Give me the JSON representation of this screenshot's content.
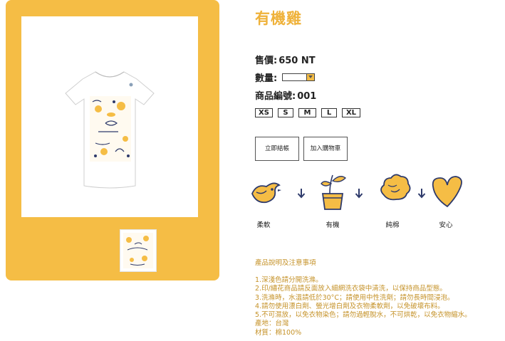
{
  "product": {
    "title": "有機雞",
    "price_label": "售價:",
    "price_value": "650 NT",
    "qty_label": "數量:",
    "qty_value": "",
    "code_label": "商品編號:",
    "code_value": "001"
  },
  "sizes": [
    "XS",
    "S",
    "M",
    "L",
    "XL"
  ],
  "actions": {
    "buy_now": "立即結帳",
    "add_to_cart": "加入購物車"
  },
  "features": [
    {
      "label": "柔軟",
      "icon": "chick-icon"
    },
    {
      "label": "有機",
      "icon": "sprout-pot-icon"
    },
    {
      "label": "純棉",
      "icon": "cotton-icon"
    },
    {
      "label": "安心",
      "icon": "heart-icon"
    }
  ],
  "description": {
    "title": "產品說明及注意事項",
    "lines": [
      "1.深淺色請分開洗滌。",
      "2.印/繡花商品請反面放入細網洗衣袋中清洗，以保持商品型態。",
      "3.洗滌時，水溫請低於30°C；請使用中性洗劑；請勿長時間浸泡。",
      "4.請勿使用漂白劑、螢光增白劑及衣物柔軟劑，以免破壞布料。",
      "5.不可濕放，以免衣物染色；請勿過輕脫水，不可烘乾，以免衣物縮水。",
      "產地：台灣",
      "材質：棉100%"
    ]
  },
  "colors": {
    "accent": "#f5bd45",
    "title": "#efb23a",
    "navy": "#2e3a6b",
    "desc_text": "#c59228"
  }
}
